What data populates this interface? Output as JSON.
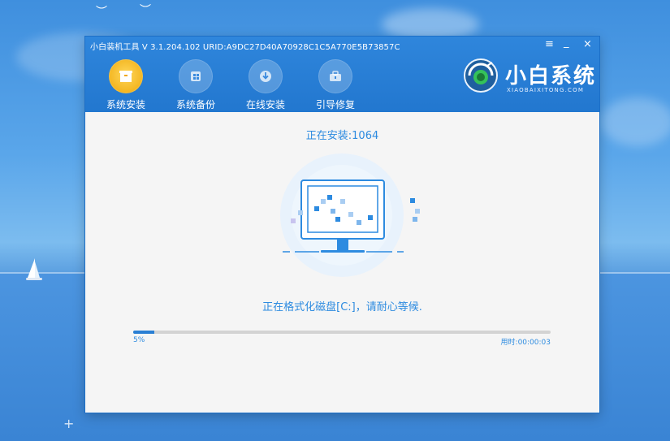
{
  "window": {
    "title": "小白装机工具 V 3.1.204.102 URID:A9DC27D40A70928C1C5A770E5B73857C",
    "controls": [
      "≡",
      "_",
      "×"
    ]
  },
  "nav": {
    "items": [
      {
        "label": "系统安装",
        "icon": "install-box-icon",
        "active": true
      },
      {
        "label": "系统备份",
        "icon": "backup-icon",
        "active": false
      },
      {
        "label": "在线安装",
        "icon": "download-icon",
        "active": false
      },
      {
        "label": "引导修复",
        "icon": "repair-toolbox-icon",
        "active": false
      }
    ]
  },
  "brand": {
    "name": "小白系统",
    "sub": "XIAOBAIXITONG.COM"
  },
  "install": {
    "status_title": "正在安装:1064",
    "step_text": "正在格式化磁盘[C:]，请耐心等候.",
    "progress_percent": 5,
    "progress_label": "5%",
    "elapsed_label": "用时:00:00:03"
  },
  "colors": {
    "header_blue": "#2a7fd4",
    "accent_text": "#2d8be0",
    "active_icon": "#f3b520"
  }
}
